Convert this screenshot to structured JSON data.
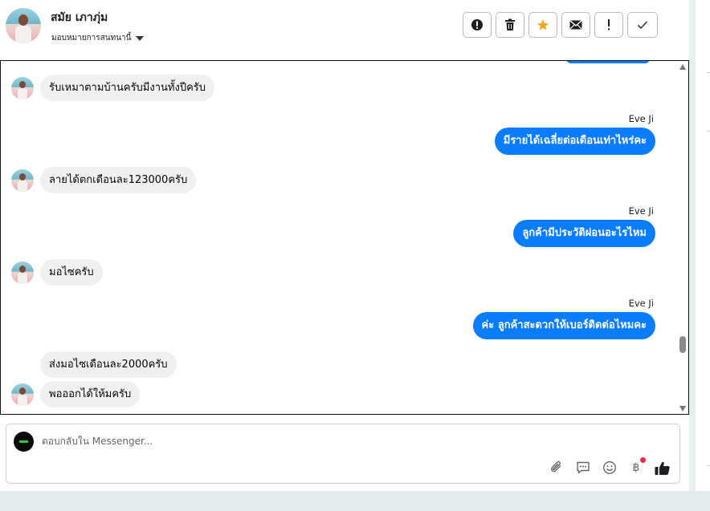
{
  "header": {
    "contact_name": "สมัย เภาภุ่ม",
    "assign_label": "มอบหมายการสนทนานี้"
  },
  "toolbar": {
    "actions": [
      {
        "name": "spam",
        "icon": "alert-circle-icon"
      },
      {
        "name": "delete",
        "icon": "trash-icon"
      },
      {
        "name": "star",
        "icon": "star-icon"
      },
      {
        "name": "mark-unread",
        "icon": "envelope-icon"
      },
      {
        "name": "follow-up",
        "icon": "exclamation-icon"
      },
      {
        "name": "done",
        "icon": "check-icon"
      }
    ]
  },
  "conversation": {
    "messages": [
      {
        "from": "customer",
        "text": "รับเหมาตามบ้านครับมีงานทั้งปีครับ",
        "avatar": true
      },
      {
        "from": "page",
        "sender": "Eve Ji",
        "text": "มีรายได้เฉลี่ยต่อเดือนเท่าไหร่คะ"
      },
      {
        "from": "customer",
        "text": "ลายได้ตกเดือนละ123000ครับ",
        "avatar": true
      },
      {
        "from": "page",
        "sender": "Eve Ji",
        "text": "ลูกค้ามีประวัติผ่อนอะไรไหม"
      },
      {
        "from": "customer",
        "text": "มอไซครับ",
        "avatar": true
      },
      {
        "from": "page",
        "sender": "Eve Ji",
        "text": "ค่ะ ลูกค้าสะดวกให้เบอร์ติดต่อไหมคะ"
      },
      {
        "from": "customer",
        "text": "ส่งมอไซเดือนละ2000ครับ",
        "avatar": false
      },
      {
        "from": "customer",
        "text": "พอออกได้ให้มครับ",
        "avatar": true
      }
    ]
  },
  "reply": {
    "placeholder": "ตอบกลับใน Messenger...",
    "tools": [
      "paperclip-icon",
      "saved-reply-icon",
      "emoji-icon",
      "baht-payment-icon",
      "thumbs-up-icon"
    ],
    "baht_symbol": "฿",
    "notification_color": "#f02849"
  },
  "colors": {
    "outgoing_bubble": "#0a7cff",
    "incoming_bubble": "#f0f0f0",
    "star": "#f5a623"
  }
}
